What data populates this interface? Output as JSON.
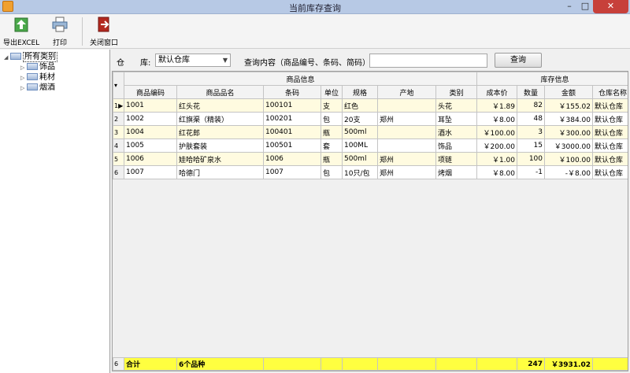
{
  "window": {
    "title": "当前库存查询",
    "min": "–",
    "max": "□",
    "close": "✕"
  },
  "toolbar": {
    "export_label": "导出EXCEL",
    "print_label": "打印",
    "close_window_label": "关闭窗口"
  },
  "tree": {
    "root": "所有类别",
    "children": [
      "饰品",
      "耗材",
      "烟酒"
    ]
  },
  "filter": {
    "warehouse_label": "仓　　库:",
    "warehouse_value": "默认仓库",
    "query_label": "查询内容（商品编号、条码、简码）",
    "query_value": "",
    "query_button": "查询"
  },
  "grid": {
    "group_headers": {
      "product_info": "商品信息",
      "stock_info": "库存信息"
    },
    "columns": [
      "商品编码",
      "商品品名",
      "条码",
      "单位",
      "规格",
      "产地",
      "类别",
      "成本价",
      "数量",
      "金额",
      "仓库名称"
    ],
    "rows": [
      {
        "num": "1",
        "code": "1001",
        "name": "红头花",
        "barcode": "100101",
        "unit": "支",
        "spec": "红色",
        "origin": "",
        "category": "头花",
        "cost": "￥1.89",
        "qty": "82",
        "amount": "￥155.02",
        "warehouse": "默认仓库"
      },
      {
        "num": "2",
        "code": "1002",
        "name": "红旗渠（精装）",
        "barcode": "100201",
        "unit": "包",
        "spec": "20支",
        "origin": "郑州",
        "category": "耳坠",
        "cost": "￥8.00",
        "qty": "48",
        "amount": "￥384.00",
        "warehouse": "默认仓库"
      },
      {
        "num": "3",
        "code": "1004",
        "name": "红花郎",
        "barcode": "100401",
        "unit": "瓶",
        "spec": "500ml",
        "origin": "",
        "category": "酒水",
        "cost": "￥100.00",
        "qty": "3",
        "amount": "￥300.00",
        "warehouse": "默认仓库"
      },
      {
        "num": "4",
        "code": "1005",
        "name": "护肤套装",
        "barcode": "100501",
        "unit": "套",
        "spec": "100ML",
        "origin": "",
        "category": "饰品",
        "cost": "￥200.00",
        "qty": "15",
        "amount": "￥3000.00",
        "warehouse": "默认仓库"
      },
      {
        "num": "5",
        "code": "1006",
        "name": "娃哈哈矿泉水",
        "barcode": "1006",
        "unit": "瓶",
        "spec": "500ml",
        "origin": "郑州",
        "category": "项链",
        "cost": "￥1.00",
        "qty": "100",
        "amount": "￥100.00",
        "warehouse": "默认仓库"
      },
      {
        "num": "6",
        "code": "1007",
        "name": "哈德门",
        "barcode": "1007",
        "unit": "包",
        "spec": "10只/包",
        "origin": "郑州",
        "category": "烤烟",
        "cost": "￥8.00",
        "qty": "-1",
        "amount": "-￥8.00",
        "warehouse": "默认仓库"
      }
    ],
    "footer": {
      "count": "6",
      "label": "合计",
      "varieties": "6个品种",
      "qty_total": "247",
      "amount_total": "￥3931.02"
    }
  },
  "colors": {
    "odd_row": "#fffbe0",
    "footer": "#ffff40",
    "titlebar": "#b7c9e5",
    "close_button": "#c7403a"
  }
}
